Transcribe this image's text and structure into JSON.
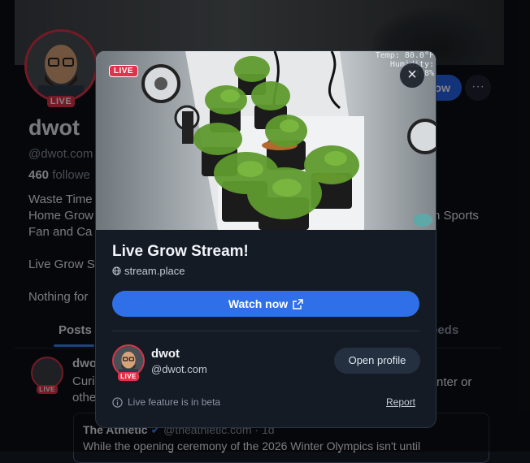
{
  "profile": {
    "name": "dwot",
    "handle": "@dwot.com",
    "followers_count": "460",
    "followers_label": "followe",
    "live_label": "LIVE",
    "bio_lines": [
      "Waste Time",
      "Home Grow",
      "Fan and Ca",
      "Live Grow S",
      "Nothing for"
    ],
    "bio_right_fragment": "n Sports",
    "follow_label": "ow",
    "more_label": "···",
    "tabs": {
      "posts": "Posts",
      "feeds": "eeds"
    }
  },
  "post": {
    "author": "dwo",
    "text_line1": "Curi",
    "text_line2": "othe",
    "text_right": "nter or",
    "quote": {
      "author": "The Athletic",
      "handle": "@theathletic.com",
      "time": "· 1d",
      "text": "While the opening ceremony of the 2026 Winter Olympics isn't until"
    }
  },
  "modal": {
    "live_badge": "LIVE",
    "thumbnail_overlay": {
      "line1": "Temp: 80.0°F",
      "line2": "Humidity: 53.8%"
    },
    "close_label": "×",
    "title": "Live Grow Stream!",
    "source": "stream.place",
    "watch_label": "Watch now",
    "streamer": {
      "name": "dwot",
      "handle": "@dwot.com",
      "live_label": "LIVE"
    },
    "open_profile_label": "Open profile",
    "beta_notice": "Live feature is in beta",
    "report_label": "Report"
  },
  "colors": {
    "accent": "#2f6fe8",
    "live": "#e0324a",
    "modal_bg": "#141b24",
    "page_bg": "#0b0f14"
  },
  "icons": [
    "globe-icon",
    "external-link-icon",
    "close-icon",
    "info-icon"
  ]
}
